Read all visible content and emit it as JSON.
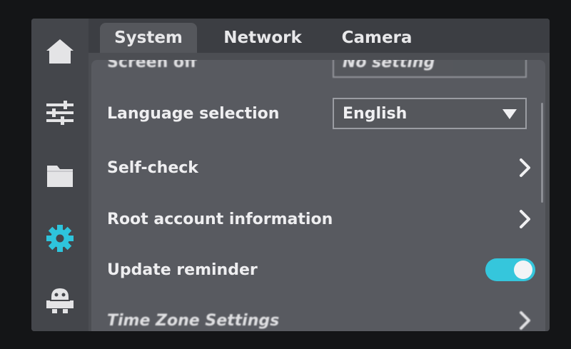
{
  "tabs": [
    {
      "label": "System",
      "active": true
    },
    {
      "label": "Network",
      "active": false
    },
    {
      "label": "Camera",
      "active": false
    }
  ],
  "sidebar": {
    "items": [
      {
        "icon": "home-icon",
        "active": false
      },
      {
        "icon": "sliders-icon",
        "active": false
      },
      {
        "icon": "folder-icon",
        "active": false
      },
      {
        "icon": "gear-icon",
        "active": true
      },
      {
        "icon": "robot-icon",
        "active": false
      }
    ],
    "active_color": "#2ec4dc",
    "inactive_color": "#e4e4e6"
  },
  "settings": {
    "screen_off": {
      "label": "Screen off",
      "value": "No setting"
    },
    "language": {
      "label": "Language selection",
      "value": "English"
    },
    "self_check": {
      "label": "Self-check"
    },
    "root_account": {
      "label": "Root account information"
    },
    "update_reminder": {
      "label": "Update reminder",
      "enabled": true
    },
    "time_zone": {
      "label": "Time Zone Settings"
    }
  },
  "colors": {
    "accent": "#35c6dc",
    "text": "#eeeef0"
  }
}
